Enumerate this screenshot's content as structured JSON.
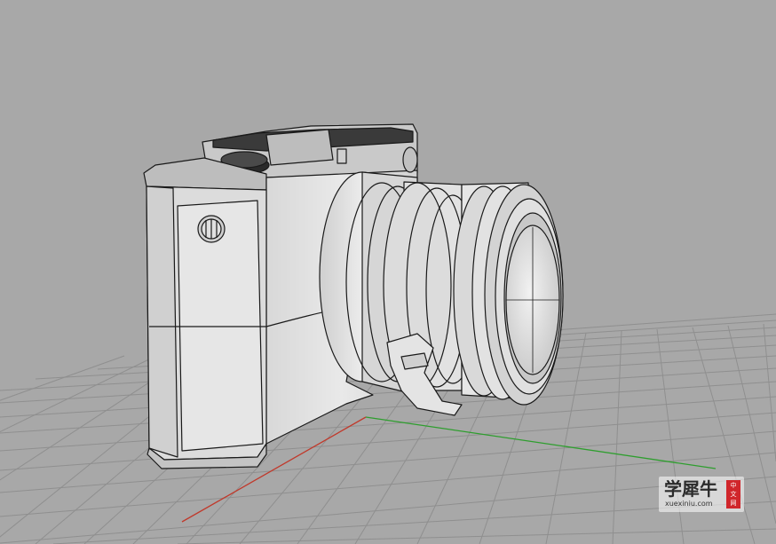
{
  "viewport": {
    "background": "#a8a8a8",
    "grid_color": "#8f8f8f",
    "x_axis_color": "#c0392b",
    "y_axis_color": "#2e9e2e",
    "model": "camera",
    "display_mode": "shaded"
  },
  "watermark": {
    "title": "学犀牛",
    "subtitle": "xuexiniu.com",
    "seal_line1": "中",
    "seal_line2": "文",
    "seal_line3": "网",
    "seal_color": "#d0262b"
  }
}
